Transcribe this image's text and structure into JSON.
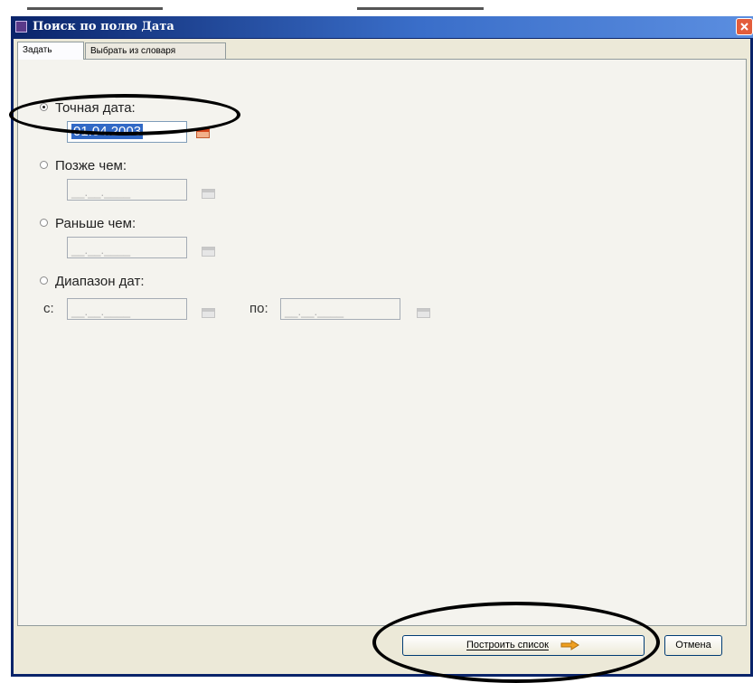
{
  "window": {
    "title": "Поиск по полю Дата"
  },
  "tabs": [
    {
      "label": "Задать",
      "active": true
    },
    {
      "label": "Выбрать из словаря",
      "active": false
    }
  ],
  "options": {
    "exact": {
      "label": "Точная дата:",
      "value": "01.04.2003",
      "selected": true
    },
    "later": {
      "label": "Позже чем:",
      "value": "__.__.____",
      "selected": false
    },
    "earlier": {
      "label": "Раньше чем:",
      "value": "__.__.____",
      "selected": false
    },
    "range": {
      "label": "Диапазон дат:",
      "from_label": "с:",
      "to_label": "по:",
      "from_value": "__.__.____",
      "to_value": "__.__.____",
      "selected": false
    }
  },
  "buttons": {
    "build_list": {
      "label": "Построить список"
    },
    "cancel": {
      "label": "Отмена"
    }
  },
  "icons": {
    "calendar": "calendar-icon",
    "arrow": "arrow-right-icon",
    "close": "close-icon"
  },
  "colors": {
    "title_bar": "#0a246a",
    "close_button": "#e35d3b",
    "selection": "#3169c6",
    "arrow": "#f0a020"
  }
}
